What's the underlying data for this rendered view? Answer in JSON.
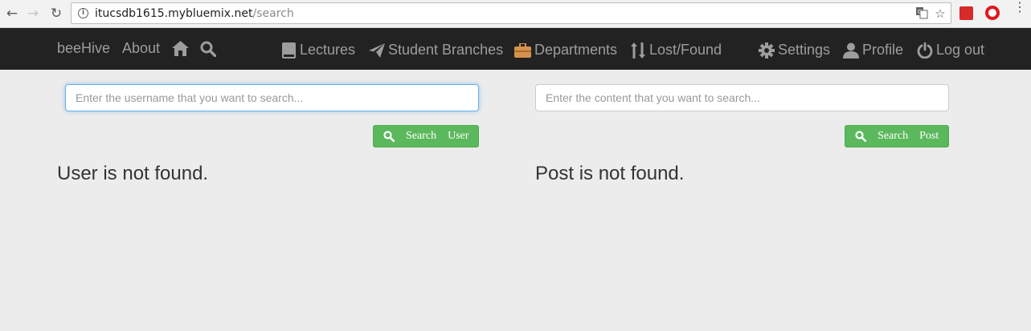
{
  "browser": {
    "url_host": "itucsdb1615.mybluemix.net",
    "url_path": "/search",
    "icons": [
      "back-icon",
      "forward-icon",
      "reload-icon",
      "info-icon",
      "translate-icon",
      "star-icon",
      "extension-icon",
      "opera-icon",
      "menu-icon"
    ]
  },
  "navbar": {
    "brand": "beeHive",
    "about": "About",
    "lectures": "Lectures",
    "student_branches": "Student Branches",
    "departments": "Departments",
    "lost_found": "Lost/Found",
    "settings": "Settings",
    "profile": "Profile",
    "logout": "Log out",
    "colors": {
      "background": "#222222",
      "text": "#9d9d9d",
      "departments_icon": "#d4934c"
    }
  },
  "user_search": {
    "placeholder": "Enter the username that you want to search...",
    "button_word1": "Search",
    "button_word2": "User",
    "result": "User is not found."
  },
  "post_search": {
    "placeholder": "Enter the content that you want to search...",
    "button_word1": "Search",
    "button_word2": "Post",
    "result": "Post is not found."
  },
  "colors": {
    "button": "#5cb85c",
    "page_bg": "#ececec"
  }
}
